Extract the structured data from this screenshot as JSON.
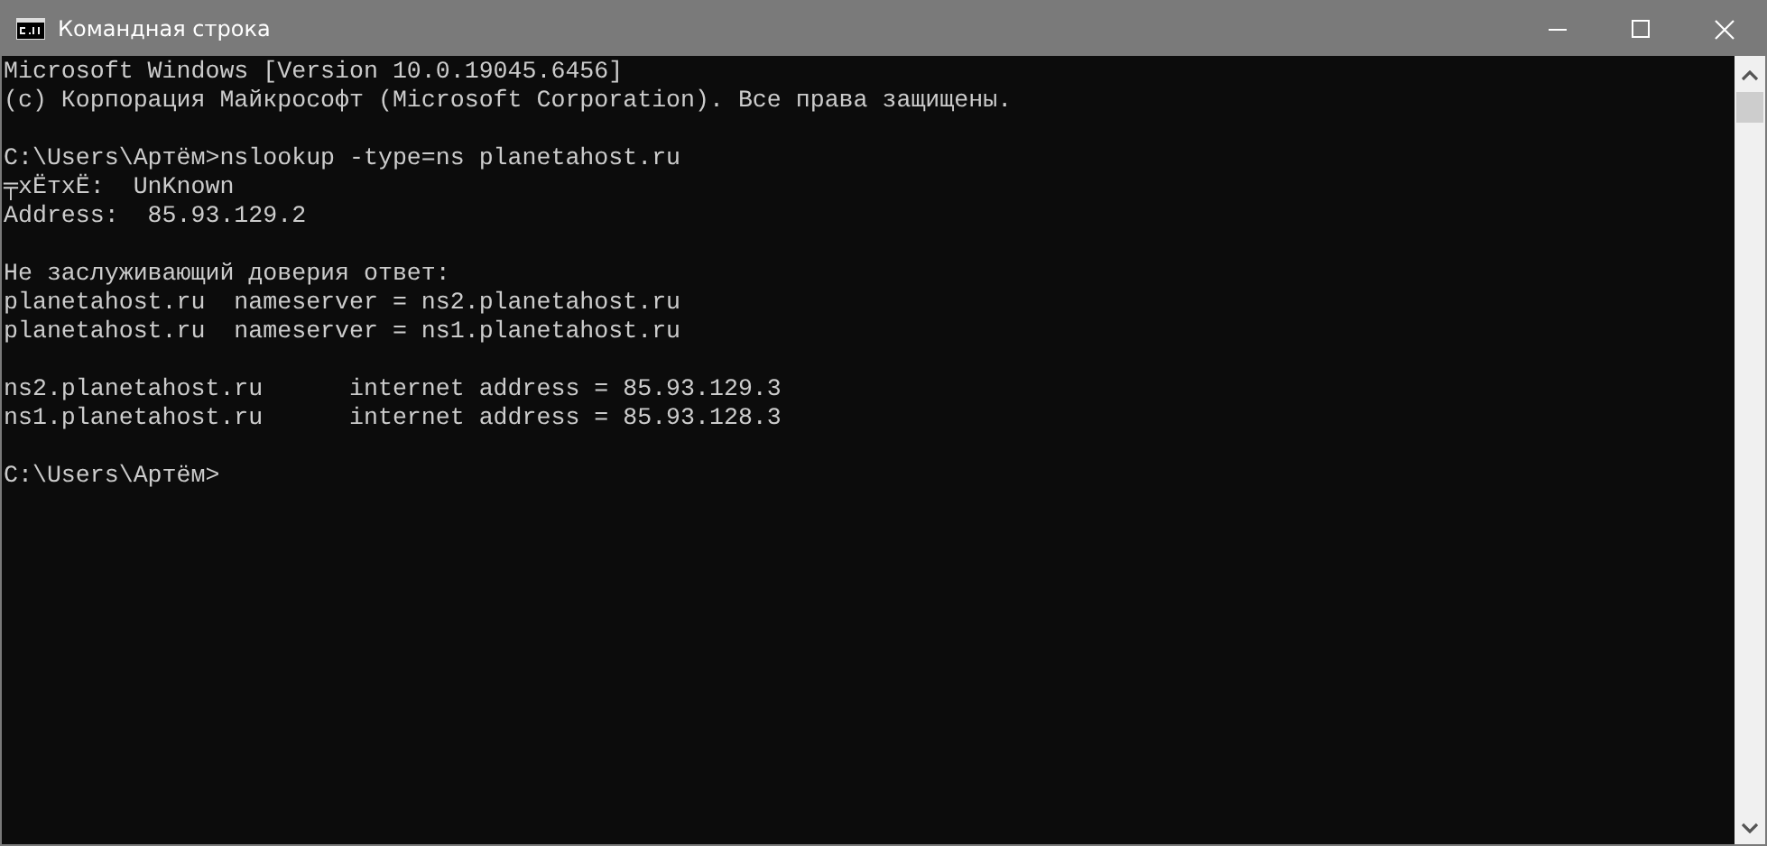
{
  "window": {
    "title": "Командная строка"
  },
  "console": {
    "blocks": [
      [
        "Microsoft Windows [Version 10.0.19045.6456]",
        "(c) Корпорация Майкрософт (Microsoft Corporation). Все права защищены."
      ],
      [
        "C:\\Users\\Артём>nslookup -type=ns planetahost.ru",
        "╤хЁтхЁ:  UnKnown",
        "Address:  85.93.129.2"
      ],
      [
        "Не заслуживающий доверия ответ:",
        "planetahost.ru  nameserver = ns2.planetahost.ru",
        "planetahost.ru  nameserver = ns1.planetahost.ru"
      ],
      [
        "ns2.planetahost.ru      internet address = 85.93.129.3",
        "ns1.planetahost.ru      internet address = 85.93.128.3"
      ],
      [
        "C:\\Users\\Артём>"
      ]
    ]
  }
}
